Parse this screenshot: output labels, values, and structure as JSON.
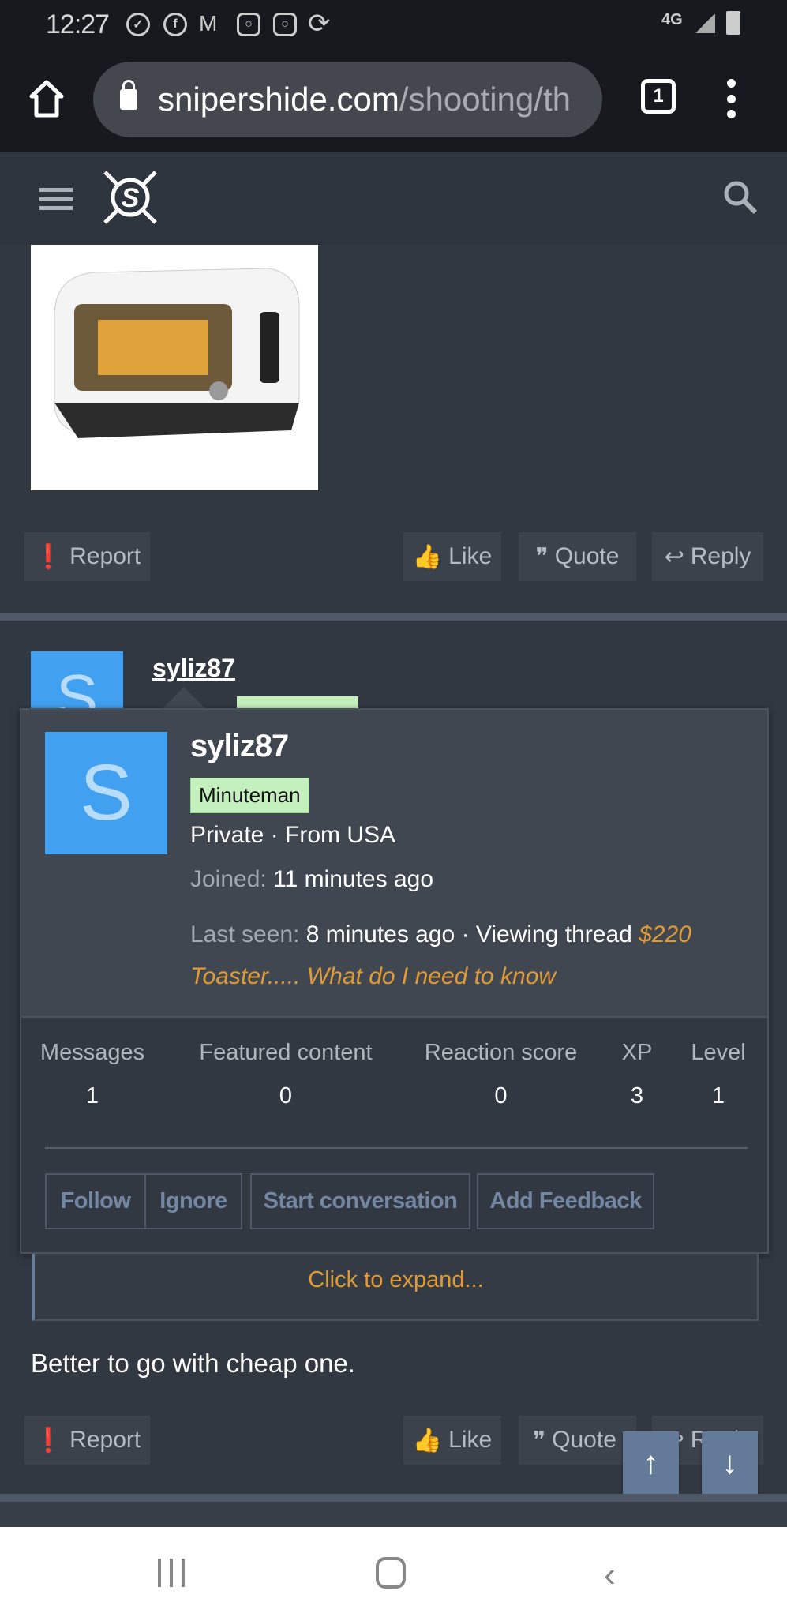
{
  "status_bar": {
    "time": "12:27",
    "network": "4G",
    "notification_icons": [
      "check-icon",
      "facebook-icon",
      "gmail-icon",
      "instagram-icon",
      "instagram-icon",
      "sync-icon"
    ]
  },
  "browser": {
    "url_host": "snipershide.com",
    "url_path": "/shooting/th",
    "tab_count": "1"
  },
  "post1": {
    "actions": {
      "report": "Report",
      "like": "Like",
      "quote": "Quote",
      "reply": "Reply"
    }
  },
  "post2": {
    "username": "syliz87",
    "avatar_letter": "S",
    "body": "Better to go with cheap one.",
    "quote_expand": "Click to expand...",
    "actions": {
      "report": "Report",
      "like": "Like",
      "quote": "Quote",
      "reply": "Reply"
    }
  },
  "popup": {
    "avatar_letter": "S",
    "username": "syliz87",
    "badge": "Minuteman",
    "info": "Private · From USA",
    "joined_label": "Joined:",
    "joined_value": "11 minutes ago",
    "last_seen_label": "Last seen:",
    "last_seen_value": "8 minutes ago · Viewing thread ",
    "thread_link": "$220 Toaster..... What do I need to know",
    "stats": [
      {
        "label": "Messages",
        "value": "1"
      },
      {
        "label": "Featured content",
        "value": "0"
      },
      {
        "label": "Reaction score",
        "value": "0"
      },
      {
        "label": "XP",
        "value": "3"
      },
      {
        "label": "Level",
        "value": "1"
      }
    ],
    "buttons": {
      "follow": "Follow",
      "ignore": "Ignore",
      "start_conversation": "Start conversation",
      "add_feedback": "Add Feedback"
    }
  },
  "colors": {
    "accent": "#e09a36",
    "badge": "#c4f0be",
    "avatar": "#42a0f0",
    "button_text": "#7387a3",
    "scroll_button": "#637b98"
  }
}
